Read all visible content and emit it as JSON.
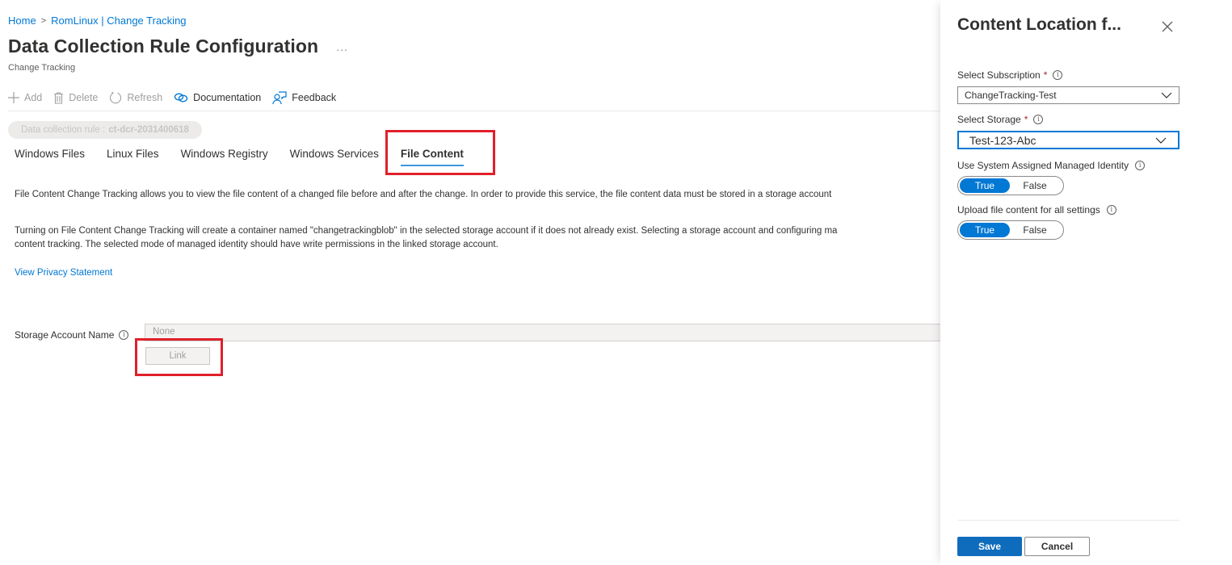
{
  "breadcrumb": {
    "items": [
      "Home",
      "RomLinux | Change Tracking"
    ],
    "separator": ">"
  },
  "header": {
    "title": "Data Collection Rule Configuration",
    "more": "...",
    "subtitle": "Change Tracking"
  },
  "toolbar": {
    "add_label": "Add",
    "delete_label": "Delete",
    "refresh_label": "Refresh",
    "documentation_label": "Documentation",
    "feedback_label": "Feedback"
  },
  "rule": {
    "label": "Data collection rule :",
    "value": "ct-dcr-2031400618"
  },
  "tabs": [
    {
      "label": "Windows Files",
      "active": false
    },
    {
      "label": "Linux Files",
      "active": false
    },
    {
      "label": "Windows Registry",
      "active": false
    },
    {
      "label": "Windows Services",
      "active": false
    },
    {
      "label": "File Content",
      "active": true
    }
  ],
  "content": {
    "para1": "File Content Change Tracking allows you to view the file content of a changed file before and after the change. In order to provide this service, the file content data must be stored in a storage account",
    "para2_line1": "Turning on File Content Change Tracking will create a container named \"changetrackingblob\" in the selected storage account if it does not already exist. Selecting a storage account and configuring ma",
    "para2_line2": "content tracking. The selected mode of managed identity should have write permissions in the linked storage account.",
    "privacy_link": "View Privacy Statement",
    "storage_label": "Storage Account Name",
    "storage_value": "None",
    "link_button": "Link"
  },
  "blade": {
    "title": "Content Location f...",
    "subscription_label": "Select Subscription",
    "subscription_value": "ChangeTracking-Test",
    "storage_label": "Select Storage",
    "storage_value": "Test-123-Abc",
    "required_mark": "*",
    "identity_label": "Use System Assigned Managed Identity",
    "identity_options": [
      "True",
      "False"
    ],
    "identity_selected": "True",
    "upload_label": "Upload file content for all settings",
    "upload_options": [
      "True",
      "False"
    ],
    "upload_selected": "True",
    "save_label": "Save",
    "cancel_label": "Cancel"
  },
  "colors": {
    "accent": "#0078d4",
    "highlight_box": "#e0202a",
    "required": "#a4262c"
  }
}
